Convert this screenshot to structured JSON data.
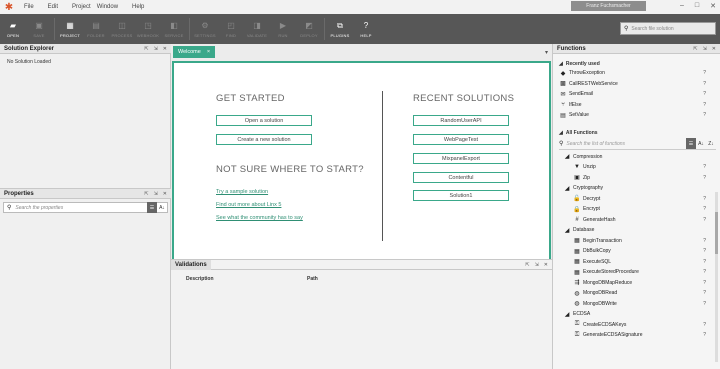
{
  "menu": {
    "items": [
      "File",
      "Edit",
      "Project",
      "Window",
      "Help"
    ],
    "user": "Franz Fuchsmacher"
  },
  "window_controls": [
    "–",
    "□",
    "✕"
  ],
  "toolbar": {
    "tools": [
      {
        "label": "OPEN",
        "icon": "folder-icon",
        "glyph": "▰",
        "active": true
      },
      {
        "label": "SAVE",
        "icon": "save-icon",
        "glyph": "▣",
        "active": false
      },
      {
        "label": "PROJECT",
        "icon": "project-icon",
        "glyph": "▦",
        "active": true
      },
      {
        "label": "FOLDER",
        "icon": "new-folder-icon",
        "glyph": "▤",
        "active": false
      },
      {
        "label": "PROCESS",
        "icon": "process-icon",
        "glyph": "◫",
        "active": false
      },
      {
        "label": "WEBHOOK",
        "icon": "webhook-icon",
        "glyph": "◳",
        "active": false
      },
      {
        "label": "SERVICE",
        "icon": "service-icon",
        "glyph": "◧",
        "active": false
      },
      {
        "label": "SETTINGS",
        "icon": "settings-icon",
        "glyph": "⚙",
        "active": false
      },
      {
        "label": "FIND",
        "icon": "find-icon",
        "glyph": "◰",
        "active": false
      },
      {
        "label": "VALIDATE",
        "icon": "validate-icon",
        "glyph": "◨",
        "active": false
      },
      {
        "label": "RUN",
        "icon": "run-icon",
        "glyph": "▶",
        "active": false
      },
      {
        "label": "DEPLOY",
        "icon": "deploy-icon",
        "glyph": "◩",
        "active": false
      },
      {
        "label": "PLUGINS",
        "icon": "plugins-icon",
        "glyph": "⧉",
        "active": true
      },
      {
        "label": "HELP",
        "icon": "help-icon",
        "glyph": "?",
        "active": true
      }
    ],
    "search_placeholder": "Search file solution"
  },
  "solution_explorer": {
    "title": "Solution Explorer",
    "empty_text": "No Solution Loaded"
  },
  "properties": {
    "title": "Properties",
    "search_placeholder": "Search the properties"
  },
  "welcome": {
    "tab_label": "Welcome",
    "get_started": "GET STARTED",
    "open_solution": "Open a solution",
    "new_solution": "Create a new solution",
    "not_sure": "NOT SURE WHERE TO START?",
    "links": [
      "Try a sample solution",
      "Find out more about Linx 5",
      "See what the community has to say"
    ],
    "recent_title": "RECENT SOLUTIONS",
    "recent": [
      "RandomUserAPI",
      "WebPageTest",
      "MixpanelExport",
      "Contentful",
      "Solution1"
    ]
  },
  "validations": {
    "title": "Validations",
    "col_description": "Description",
    "col_path": "Path"
  },
  "functions": {
    "title": "Functions",
    "recently_used_label": "Recently used",
    "recently_used": [
      {
        "name": "ThrowException",
        "icon": "throw-exception-icon",
        "glyph": "◆"
      },
      {
        "name": "CallRESTWebService",
        "icon": "rest-icon",
        "glyph": "▩"
      },
      {
        "name": "SendEmail",
        "icon": "email-icon",
        "glyph": "✉"
      },
      {
        "name": "IfElse",
        "icon": "ifelse-icon",
        "glyph": "⑂"
      },
      {
        "name": "SetValue",
        "icon": "setvalue-icon",
        "glyph": "▤"
      }
    ],
    "all_label": "All Functions",
    "search_placeholder": "Search the list of functions",
    "categories": [
      {
        "name": "Compression",
        "items": [
          {
            "name": "Unzip",
            "glyph": "▼"
          },
          {
            "name": "Zip",
            "glyph": "▣"
          }
        ]
      },
      {
        "name": "Cryptography",
        "items": [
          {
            "name": "Decrypt",
            "glyph": "🔓"
          },
          {
            "name": "Encrypt",
            "glyph": "🔒"
          },
          {
            "name": "GenerateHash",
            "glyph": "#"
          }
        ]
      },
      {
        "name": "Database",
        "items": [
          {
            "name": "BeginTransaction",
            "glyph": "▦"
          },
          {
            "name": "DbBulkCopy",
            "glyph": "▦"
          },
          {
            "name": "ExecuteSQL",
            "glyph": "▦"
          },
          {
            "name": "ExecuteStoredProcedure",
            "glyph": "▦"
          },
          {
            "name": "MongoDBMapReduce",
            "glyph": "⇶"
          },
          {
            "name": "MongoDBRead",
            "glyph": "◍"
          },
          {
            "name": "MongoDBWrite",
            "glyph": "◍"
          }
        ]
      },
      {
        "name": "ECDSA",
        "items": [
          {
            "name": "CreateECDSAKeys",
            "glyph": "⚿"
          },
          {
            "name": "GenerateECDSASignature",
            "glyph": "⚿"
          }
        ]
      }
    ]
  }
}
